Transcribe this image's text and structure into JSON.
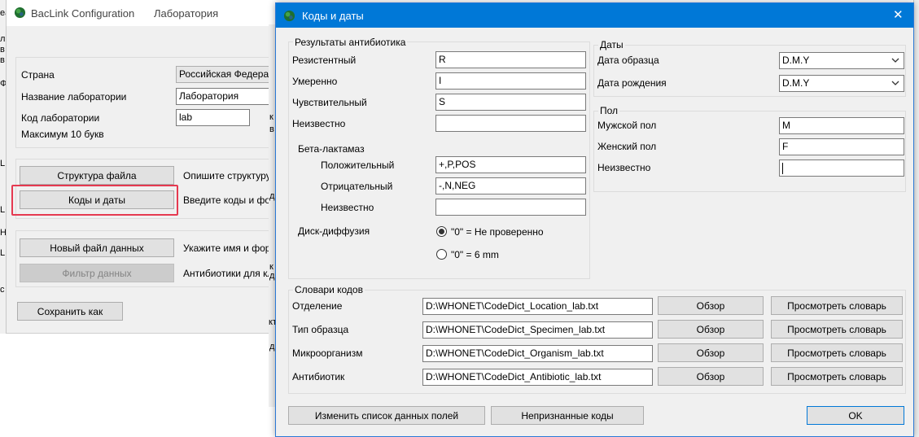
{
  "bg_window": {
    "title": "BacLink Configuration",
    "subtitle": "Лаборатория",
    "fields": {
      "country_label": "Страна",
      "country_value": "Российская Федера",
      "lab_name_label": "Название лаборатории",
      "lab_name_value": "Лаборатория",
      "lab_code_label": "Код лаборатории",
      "lab_code_value": "lab",
      "max_note": "Максимум 10 букв"
    },
    "buttons": {
      "file_structure": "Структура файла",
      "file_structure_desc": "Опишите структуру",
      "codes_dates": "Коды и даты",
      "codes_dates_desc": "Введите коды и фо",
      "new_data_file": "Новый файл данных",
      "new_data_file_desc": "Укажите имя и фор",
      "data_filter": "Фильтр данных",
      "data_filter_desc": "Антибиотики для кл",
      "save_as": "Сохранить как"
    },
    "left_edge_chars": [
      "ea",
      "л",
      "в",
      "в",
      "Ф",
      "L",
      "L",
      "Н",
      "L",
      "с"
    ],
    "right_edge_chars": [
      "к",
      "в",
      "д",
      "к",
      "д",
      "кт",
      "д"
    ]
  },
  "dialog": {
    "title": "Коды и даты",
    "close_glyph": "✕",
    "antibiotic_results": {
      "title": "Результаты антибиотика",
      "rows": [
        {
          "label": "Резистентный",
          "value": "R"
        },
        {
          "label": "Умеренно",
          "value": "I"
        },
        {
          "label": "Чувствительный",
          "value": "S"
        },
        {
          "label": "Неизвестно",
          "value": ""
        }
      ],
      "beta_title": "Бета-лактамаз",
      "beta_rows": [
        {
          "label": "Положительный",
          "value": "+,P,POS"
        },
        {
          "label": "Отрицательный",
          "value": "-,N,NEG"
        },
        {
          "label": "Неизвестно",
          "value": ""
        }
      ],
      "disk_label": "Диск-диффузия",
      "disk_options": [
        {
          "label": "\"0\" = Не проверенно",
          "selected": true
        },
        {
          "label": "\"0\" = 6 mm",
          "selected": false
        }
      ]
    },
    "dates": {
      "title": "Даты",
      "rows": [
        {
          "label": "Дата образца",
          "value": "D.M.Y"
        },
        {
          "label": "Дата рождения",
          "value": "D.M.Y"
        }
      ]
    },
    "sex": {
      "title": "Пол",
      "rows": [
        {
          "label": "Мужской пол",
          "value": "M"
        },
        {
          "label": "Женский пол",
          "value": "F"
        },
        {
          "label": "Неизвестно",
          "value": ""
        }
      ]
    },
    "code_dicts": {
      "title": "Словари кодов",
      "browse_label": "Обзор",
      "view_label": "Просмотреть словарь",
      "rows": [
        {
          "label": "Отделение",
          "path": "D:\\WHONET\\CodeDict_Location_lab.txt"
        },
        {
          "label": "Тип образца",
          "path": "D:\\WHONET\\CodeDict_Specimen_lab.txt"
        },
        {
          "label": "Микроорганизм",
          "path": "D:\\WHONET\\CodeDict_Organism_lab.txt"
        },
        {
          "label": "Антибиотик",
          "path": "D:\\WHONET\\CodeDict_Antibiotic_lab.txt"
        }
      ]
    },
    "footer": {
      "edit_fields": "Изменить список данных полей",
      "unrecognized": "Непризнанные коды",
      "ok": "OK"
    }
  },
  "colors": {
    "dialog_titlebar": "#0078d7",
    "highlight": "#e53950",
    "window_bg": "#f0f0f0"
  }
}
